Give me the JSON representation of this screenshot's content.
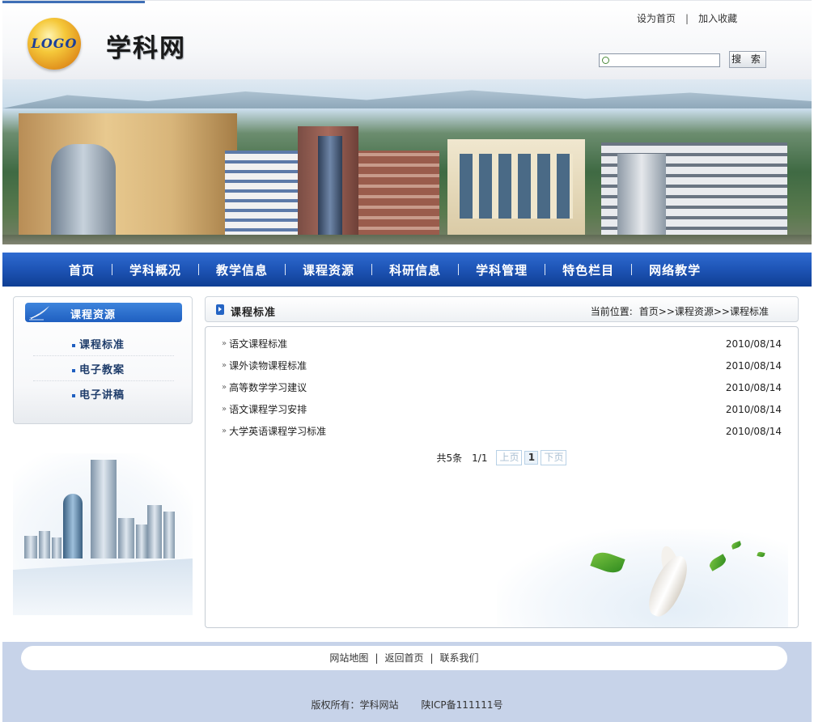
{
  "header": {
    "logo_text": "LOGO",
    "site_title": "学科网",
    "links": [
      "设为首页",
      "加入收藏"
    ],
    "search": {
      "value": "",
      "placeholder": "",
      "button_label": "搜 索"
    }
  },
  "nav": {
    "items": [
      {
        "label": "首页"
      },
      {
        "label": "学科概况"
      },
      {
        "label": "教学信息"
      },
      {
        "label": "课程资源"
      },
      {
        "label": "科研信息"
      },
      {
        "label": "学科管理"
      },
      {
        "label": "特色栏目"
      },
      {
        "label": "网络教学"
      }
    ]
  },
  "sidebar": {
    "title": "课程资源",
    "items": [
      {
        "label": "课程标准"
      },
      {
        "label": "电子教案"
      },
      {
        "label": "电子讲稿"
      }
    ]
  },
  "content": {
    "title": "课程标准",
    "breadcrumb_label": "当前位置:",
    "breadcrumb": "首页>>课程资源>>课程标准",
    "articles": [
      {
        "title": "语文课程标准",
        "date": "2010/08/14"
      },
      {
        "title": "课外读物课程标准",
        "date": "2010/08/14"
      },
      {
        "title": "高等数学学习建议",
        "date": "2010/08/14"
      },
      {
        "title": "语文课程学习安排",
        "date": "2010/08/14"
      },
      {
        "title": "大学英语课程学习标准",
        "date": "2010/08/14"
      }
    ],
    "pager": {
      "total": "共5条",
      "page": "1/1",
      "prev": "上页",
      "current": "1",
      "next": "下页"
    }
  },
  "footer": {
    "links": [
      "网站地图",
      "返回首页",
      "联系我们"
    ],
    "copyright": "版权所有：学科网站",
    "icp": "陕ICP备111111号"
  },
  "colors": {
    "nav_blue": "#1f56b8",
    "sidebar_head": "#1f5fc0",
    "footer_bg": "#c7d3e9"
  }
}
